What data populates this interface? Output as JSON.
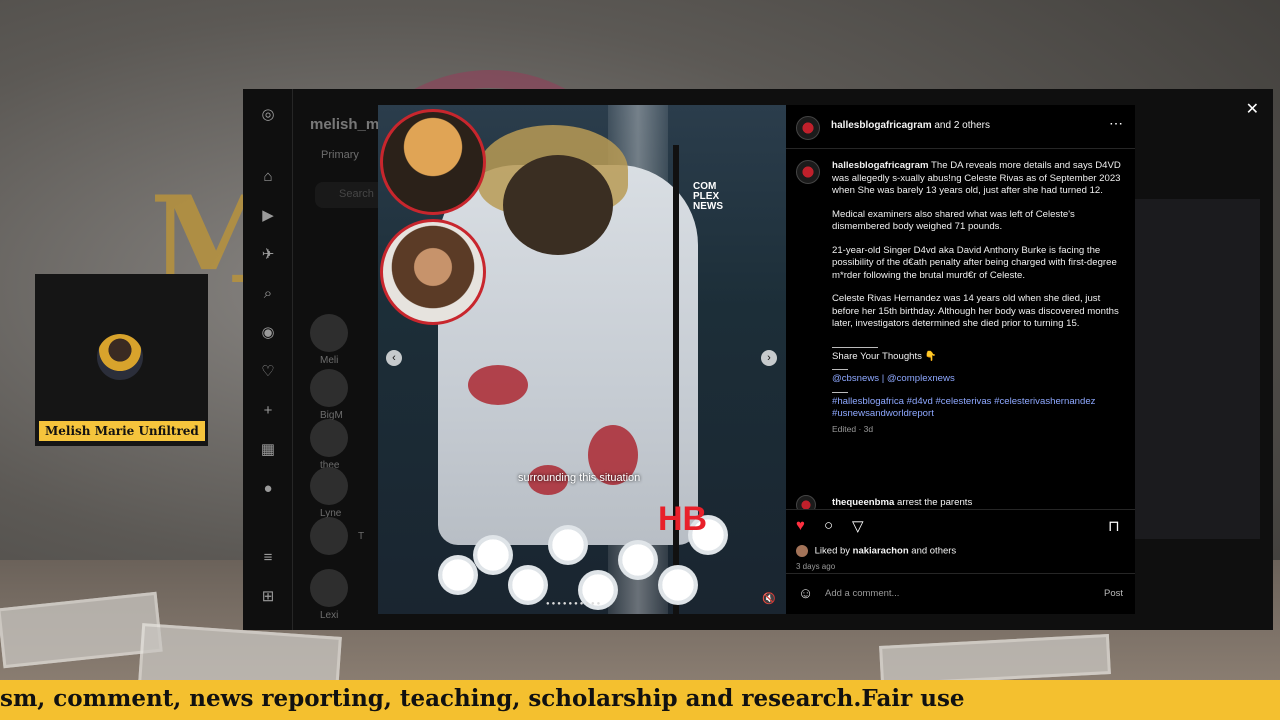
{
  "stream": {
    "cam_label": "Melish Marie Unfiltred",
    "ticker_text": "sm, comment, news reporting, teaching, scholarship and research.Fair use"
  },
  "instagram": {
    "dm_panel": {
      "username": "melish_ma",
      "tab": "Primary",
      "search_placeholder": "Search",
      "rows": [
        "Meli",
        "BigM",
        "thee",
        "Lyne",
        "T",
        "Lexi"
      ]
    },
    "post": {
      "header_user": "hallesblogafricagram",
      "header_rest": "and 2 others",
      "video_subtitle": "surrounding this situation",
      "overlay_logo_top": "COM\nPLEX\nNEWS",
      "overlay_logo_bottom": "HB",
      "caption_user": "hallesblogafricagram",
      "caption_p1": "The DA reveals more details and says D4VD was allegedly s-xually abus!ng Celeste Rivas as of September 2023 when She was barely 13 years old, just after she had turned 12.",
      "caption_p2": "Medical examiners also shared what was left of Celeste's dismembered body weighed 71 pounds.",
      "caption_p3": "21-year-old Singer D4vd aka David Anthony Burke is facing the possibility of the d€ath penalty after being charged with first-degree m*rder following the brutal murd€r of Celeste.",
      "caption_p4": "Celeste Rivas Hernandez was 14 years old when she died, just before her 15th birthday. Although her body was discovered months later, investigators determined she died prior to turning 15.",
      "share_line": "Share Your Thoughts 👇",
      "credits": "@cbsnews | @complexnews",
      "hashtags": "#hallesblogafrica #d4vd #celesterivas #celesterivashernandez #usnewsandworldreport",
      "edited": "Edited · 3d",
      "comment_user": "thequeenbma",
      "comment_text": "arrest the parents",
      "liked_by_prefix": "Liked by",
      "liked_by_user": "nakiarachon",
      "liked_by_suffix": "and others",
      "posted_time": "3 days ago",
      "add_comment_placeholder": "Add a comment...",
      "post_button": "Post"
    }
  },
  "colors": {
    "ticker": "#f4c02f",
    "cam_tag": "#f5c43c",
    "heart": "#ff3040",
    "link": "#8ea8ff"
  }
}
